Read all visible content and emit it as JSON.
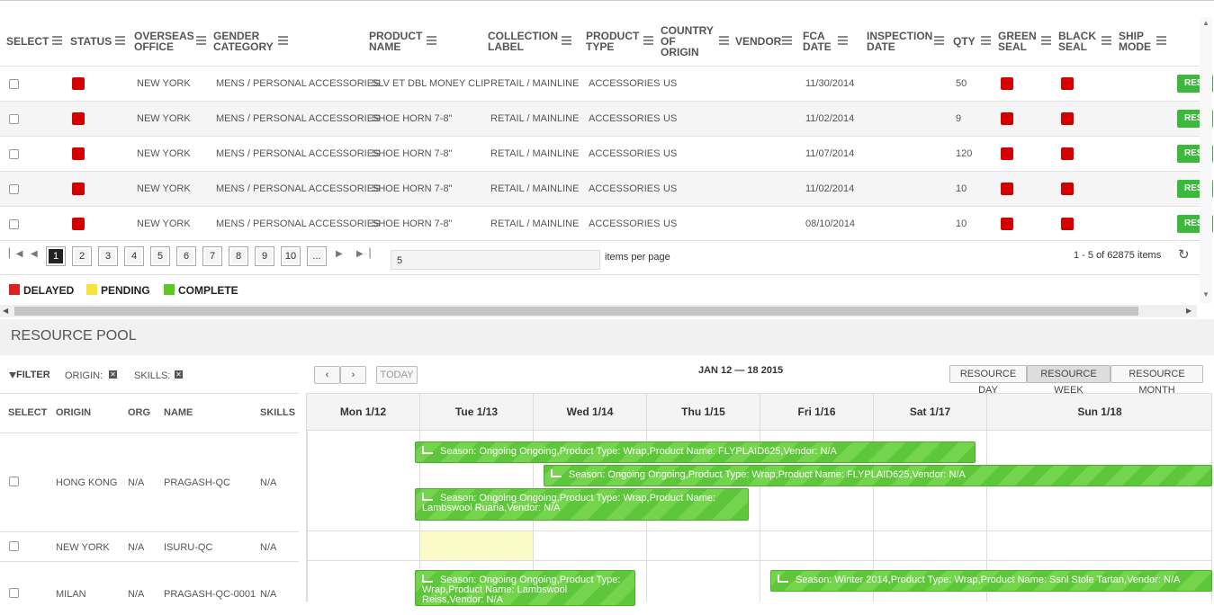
{
  "grid": {
    "headers": [
      {
        "label": "SELECT"
      },
      {
        "label": "STATUS"
      },
      {
        "label": "OVERSEAS OFFICE"
      },
      {
        "label": "GENDER CATEGORY"
      },
      {
        "label": "PRODUCT NAME"
      },
      {
        "label": "COLLECTION LABEL"
      },
      {
        "label": "PRODUCT TYPE"
      },
      {
        "label": "COUNTRY OF ORIGIN"
      },
      {
        "label": "VENDOR"
      },
      {
        "label": "FCA DATE"
      },
      {
        "label": "INSPECTION DATE"
      },
      {
        "label": "QTY"
      },
      {
        "label": "GREEN SEAL"
      },
      {
        "label": "BLACK SEAL"
      },
      {
        "label": "SHIP MODE"
      }
    ],
    "rows": [
      {
        "office": "NEW YORK",
        "gender": "MENS / PERSONAL ACCESSORIES",
        "product": "SLV ET DBL MONEY CLIP",
        "collection": "RETAIL / MAINLINE",
        "type": "ACCESSORIES",
        "country": "US",
        "vendor": "",
        "fca": "11/30/2014",
        "inspection": "",
        "qty": "50",
        "status": "delayed",
        "green_seal": "delayed",
        "black_seal": "delayed",
        "button": "RES"
      },
      {
        "office": "NEW YORK",
        "gender": "MENS / PERSONAL ACCESSORIES",
        "product": "SHOE HORN 7-8\"",
        "collection": "RETAIL / MAINLINE",
        "type": "ACCESSORIES",
        "country": "US",
        "vendor": "",
        "fca": "11/02/2014",
        "inspection": "",
        "qty": "9",
        "status": "delayed",
        "green_seal": "delayed",
        "black_seal": "delayed",
        "button": "RES"
      },
      {
        "office": "NEW YORK",
        "gender": "MENS / PERSONAL ACCESSORIES",
        "product": "SHOE HORN 7-8\"",
        "collection": "RETAIL / MAINLINE",
        "type": "ACCESSORIES",
        "country": "US",
        "vendor": "",
        "fca": "11/07/2014",
        "inspection": "",
        "qty": "120",
        "status": "delayed",
        "green_seal": "delayed",
        "black_seal": "delayed",
        "button": "RES"
      },
      {
        "office": "NEW YORK",
        "gender": "MENS / PERSONAL ACCESSORIES",
        "product": "SHOE HORN 7-8\"",
        "collection": "RETAIL / MAINLINE",
        "type": "ACCESSORIES",
        "country": "US",
        "vendor": "",
        "fca": "11/02/2014",
        "inspection": "",
        "qty": "10",
        "status": "delayed",
        "green_seal": "delayed",
        "black_seal": "delayed",
        "button": "RES"
      },
      {
        "office": "NEW YORK",
        "gender": "MENS / PERSONAL ACCESSORIES",
        "product": "SHOE HORN 7-8\"",
        "collection": "RETAIL / MAINLINE",
        "type": "ACCESSORIES",
        "country": "US",
        "vendor": "",
        "fca": "08/10/2014",
        "inspection": "",
        "qty": "10",
        "status": "delayed",
        "green_seal": "delayed",
        "black_seal": "delayed",
        "button": "RES"
      }
    ],
    "pager": {
      "pages": [
        "1",
        "2",
        "3",
        "4",
        "5",
        "6",
        "7",
        "8",
        "9",
        "10",
        "..."
      ],
      "current_page": "1",
      "items_per_page_value": "5",
      "items_per_page_label": "items per page",
      "summary": "1 - 5 of 62875 items"
    },
    "legend": [
      {
        "label": "DELAYED",
        "color": "#e02020"
      },
      {
        "label": "PENDING",
        "color": "#f5e53a"
      },
      {
        "label": "COMPLETE",
        "color": "#5ec822"
      }
    ]
  },
  "resource_pool": {
    "title": "RESOURCE POOL",
    "filter": {
      "label": "FILTER",
      "origin_label": "ORIGIN:",
      "skills_label": "SKILLS:"
    },
    "headers": [
      "SELECT",
      "ORIGIN",
      "ORG",
      "NAME",
      "SKILLS"
    ],
    "rows": [
      {
        "origin": "HONG KONG",
        "org": "N/A",
        "name": "PRAGASH-QC",
        "skills": "N/A"
      },
      {
        "origin": "NEW YORK",
        "org": "N/A",
        "name": "ISURU-QC",
        "skills": "N/A"
      },
      {
        "origin": "MILAN",
        "org": "N/A",
        "name": "PRAGASH-QC-0001",
        "skills": "N/A"
      }
    ]
  },
  "calendar": {
    "today_label": "TODAY",
    "range": "JAN 12 — 18 2015",
    "views": [
      "RESOURCE DAY",
      "RESOURCE WEEK",
      "RESOURCE MONTH"
    ],
    "selected_view": "RESOURCE WEEK",
    "days": [
      "Mon 1/12",
      "Tue 1/13",
      "Wed 1/14",
      "Thu 1/15",
      "Fri 1/16",
      "Sat 1/17",
      "Sun 1/18"
    ],
    "events": [
      {
        "text": "Season: Ongoing Ongoing,Product Type: Wrap,Product Name: FLYPLAID625,Vendor: N/A",
        "resource": "PRAGASH-QC"
      },
      {
        "text": "Season: Ongoing Ongoing,Product Type: Wrap,Product Name: FLYPLAID625,Vendor: N/A",
        "resource": "PRAGASH-QC"
      },
      {
        "text": "Season: Ongoing Ongoing,Product Type: Wrap,Product Name: Lambswool Ruaria,Vendor: N/A",
        "resource": "PRAGASH-QC"
      },
      {
        "text": "Season: Ongoing Ongoing,Product Type: Wrap,Product Name: Lambswool Reiss,Vendor: N/A",
        "resource": "PRAGASH-QC-0001"
      },
      {
        "text": "Season: Winter 2014,Product Type: Wrap,Product Name: Ssnl Stole Tartan,Vendor: N/A",
        "resource": "PRAGASH-QC-0001"
      }
    ],
    "highlight_color": "#fbfbc8"
  }
}
